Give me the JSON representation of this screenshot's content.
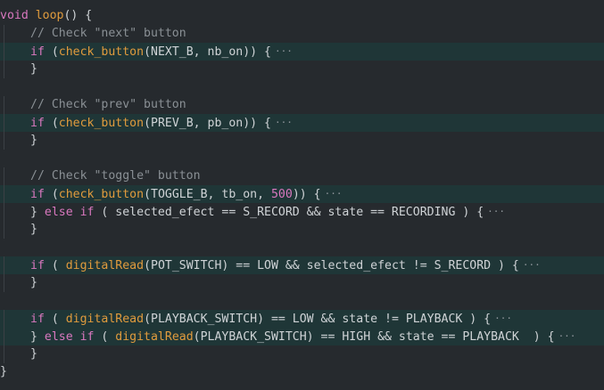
{
  "editor": {
    "lines": [
      {
        "tokens": [
          {
            "t": "kw",
            "v": "void"
          },
          {
            "t": "plain",
            "v": " "
          },
          {
            "t": "fn",
            "v": "loop"
          },
          {
            "t": "plain",
            "v": "() {"
          }
        ],
        "indent": 0,
        "fold": false
      },
      {
        "tokens": [
          {
            "t": "cmt",
            "v": "// Check \"next\" button"
          }
        ],
        "indent": 1,
        "fold": false
      },
      {
        "tokens": [
          {
            "t": "kw",
            "v": "if"
          },
          {
            "t": "plain",
            "v": " ("
          },
          {
            "t": "fn",
            "v": "check_button"
          },
          {
            "t": "plain",
            "v": "(NEXT_B, nb_on)) {"
          }
        ],
        "indent": 1,
        "fold": true,
        "ellipsis": "···"
      },
      {
        "tokens": [
          {
            "t": "plain",
            "v": "}"
          }
        ],
        "indent": 1,
        "fold": false
      },
      {
        "tokens": [],
        "indent": 0,
        "fold": false
      },
      {
        "tokens": [
          {
            "t": "cmt",
            "v": "// Check \"prev\" button"
          }
        ],
        "indent": 1,
        "fold": false
      },
      {
        "tokens": [
          {
            "t": "kw",
            "v": "if"
          },
          {
            "t": "plain",
            "v": " ("
          },
          {
            "t": "fn",
            "v": "check_button"
          },
          {
            "t": "plain",
            "v": "(PREV_B, pb_on)) {"
          }
        ],
        "indent": 1,
        "fold": true,
        "ellipsis": "···"
      },
      {
        "tokens": [
          {
            "t": "plain",
            "v": "}"
          }
        ],
        "indent": 1,
        "fold": false
      },
      {
        "tokens": [],
        "indent": 0,
        "fold": false
      },
      {
        "tokens": [
          {
            "t": "cmt",
            "v": "// Check \"toggle\" button"
          }
        ],
        "indent": 1,
        "fold": false
      },
      {
        "tokens": [
          {
            "t": "kw",
            "v": "if"
          },
          {
            "t": "plain",
            "v": " ("
          },
          {
            "t": "fn",
            "v": "check_button"
          },
          {
            "t": "plain",
            "v": "(TOGGLE_B, tb_on, "
          },
          {
            "t": "num",
            "v": "500"
          },
          {
            "t": "plain",
            "v": ")) {"
          }
        ],
        "indent": 1,
        "fold": true,
        "ellipsis": "···"
      },
      {
        "tokens": [
          {
            "t": "plain",
            "v": "} "
          },
          {
            "t": "kw",
            "v": "else if"
          },
          {
            "t": "plain",
            "v": " ( selected_efect == S_RECORD && state == RECORDING ) {"
          }
        ],
        "indent": 1,
        "fold": false,
        "ellipsis": "···"
      },
      {
        "tokens": [
          {
            "t": "plain",
            "v": "}"
          }
        ],
        "indent": 1,
        "fold": false
      },
      {
        "tokens": [],
        "indent": 0,
        "fold": false
      },
      {
        "tokens": [
          {
            "t": "kw",
            "v": "if"
          },
          {
            "t": "plain",
            "v": " ( "
          },
          {
            "t": "fn",
            "v": "digitalRead"
          },
          {
            "t": "plain",
            "v": "(POT_SWITCH) == LOW && selected_efect != S_RECORD ) {"
          }
        ],
        "indent": 1,
        "fold": true,
        "ellipsis": "···"
      },
      {
        "tokens": [
          {
            "t": "plain",
            "v": "}"
          }
        ],
        "indent": 1,
        "fold": false
      },
      {
        "tokens": [],
        "indent": 0,
        "fold": false
      },
      {
        "tokens": [
          {
            "t": "kw",
            "v": "if"
          },
          {
            "t": "plain",
            "v": " ( "
          },
          {
            "t": "fn",
            "v": "digitalRead"
          },
          {
            "t": "plain",
            "v": "(PLAYBACK_SWITCH) == LOW && state != PLAYBACK ) {"
          }
        ],
        "indent": 1,
        "fold": true,
        "ellipsis": "···"
      },
      {
        "tokens": [
          {
            "t": "plain",
            "v": "} "
          },
          {
            "t": "kw",
            "v": "else if"
          },
          {
            "t": "plain",
            "v": " ( "
          },
          {
            "t": "fn",
            "v": "digitalRead"
          },
          {
            "t": "plain",
            "v": "(PLAYBACK_SWITCH) == HIGH && state == PLAYBACK  ) {"
          }
        ],
        "indent": 1,
        "fold": true,
        "ellipsis": "···"
      },
      {
        "tokens": [
          {
            "t": "plain",
            "v": "}"
          }
        ],
        "indent": 1,
        "fold": false
      },
      {
        "tokens": [
          {
            "t": "plain",
            "v": "}"
          }
        ],
        "indent": 0,
        "fold": false
      }
    ]
  },
  "colors": {
    "background": "#262a2e",
    "fold_highlight": "#1f3637",
    "keyword": "#d978bf",
    "function": "#e09b3d",
    "comment": "#8a9095",
    "text": "#cfd3d6"
  }
}
